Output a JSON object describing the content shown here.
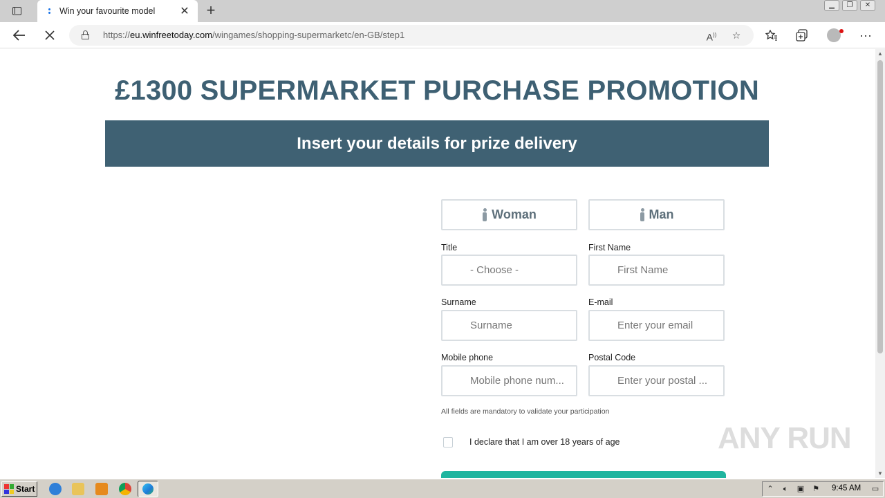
{
  "browser": {
    "tab": {
      "title": "Win your favourite model",
      "close_glyph": "✕"
    },
    "new_tab_glyph": "+",
    "address": {
      "url_prefix": "https://",
      "url_host": "eu.winfreetoday.com",
      "url_path": "/wingames/shopping-supermarketc/en-GB/step1"
    }
  },
  "page": {
    "promo_title": "£1300 SUPERMARKET PURCHASE PROMOTION",
    "banner_text": "Insert your details for prize delivery",
    "gender": {
      "woman": "Woman",
      "man": "Man"
    },
    "form": {
      "title_label": "Title",
      "title_value": "- Choose -",
      "first_name_label": "First Name",
      "first_name_placeholder": "First Name",
      "surname_label": "Surname",
      "surname_placeholder": "Surname",
      "email_label": "E-mail",
      "email_placeholder": "Enter your email",
      "mobile_label": "Mobile phone",
      "mobile_placeholder": "Mobile phone num...",
      "postal_label": "Postal Code",
      "postal_placeholder": "Enter your postal ..."
    },
    "mandatory_note": "All fields are mandatory to validate your participation",
    "age_declaration": "I declare that I am over 18 years of age",
    "watermark": "ANY RUN"
  },
  "taskbar": {
    "start_label": "Start",
    "clock": "9:45 AM"
  },
  "colors": {
    "accent": "#3f6173",
    "submit": "#1fb59f",
    "field_border": "#d9dee2"
  }
}
